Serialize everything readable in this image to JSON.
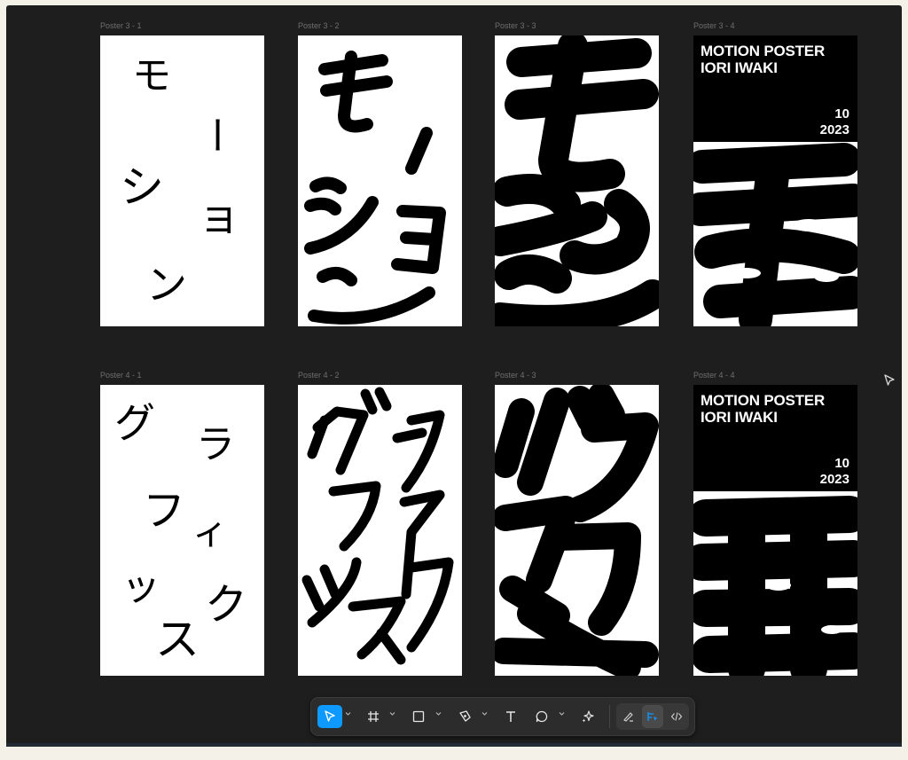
{
  "frames": [
    {
      "label": "Poster 3 - 1"
    },
    {
      "label": "Poster 3 - 2"
    },
    {
      "label": "Poster 3 - 3"
    },
    {
      "label": "Poster 3 - 4",
      "title": "MOTION POSTER\nIORI IWAKI",
      "date": "10\n2023"
    },
    {
      "label": "Poster 4 - 1"
    },
    {
      "label": "Poster 4 - 2"
    },
    {
      "label": "Poster 4 - 3"
    },
    {
      "label": "Poster 4 - 4",
      "title": "MOTION POSTER\nIORI IWAKI",
      "date": "10\n2023"
    }
  ],
  "poster_text": {
    "row3": [
      "モ",
      "ー",
      "シ",
      "ョ",
      "ン"
    ],
    "row4": [
      "グ",
      "ラ",
      "フ",
      "ィ",
      "ッ",
      "ク",
      "ス"
    ]
  },
  "toolbar": {
    "tools": [
      {
        "icon": "move-pointer-icon",
        "active": true
      },
      {
        "icon": "frame-hash-icon"
      },
      {
        "icon": "rectangle-shape-icon"
      },
      {
        "icon": "pen-tool-icon"
      },
      {
        "icon": "text-tool-icon"
      },
      {
        "icon": "comment-bubble-icon"
      },
      {
        "icon": "ai-actions-sparkle-icon"
      }
    ],
    "modes": [
      {
        "icon": "draw-mode-icon"
      },
      {
        "icon": "design-mode-icon",
        "active": true
      },
      {
        "icon": "dev-mode-code-icon"
      }
    ]
  },
  "colors": {
    "canvas": "#1e1e1e",
    "accent": "#0d99ff",
    "toolbar": "#2c2c2c"
  }
}
